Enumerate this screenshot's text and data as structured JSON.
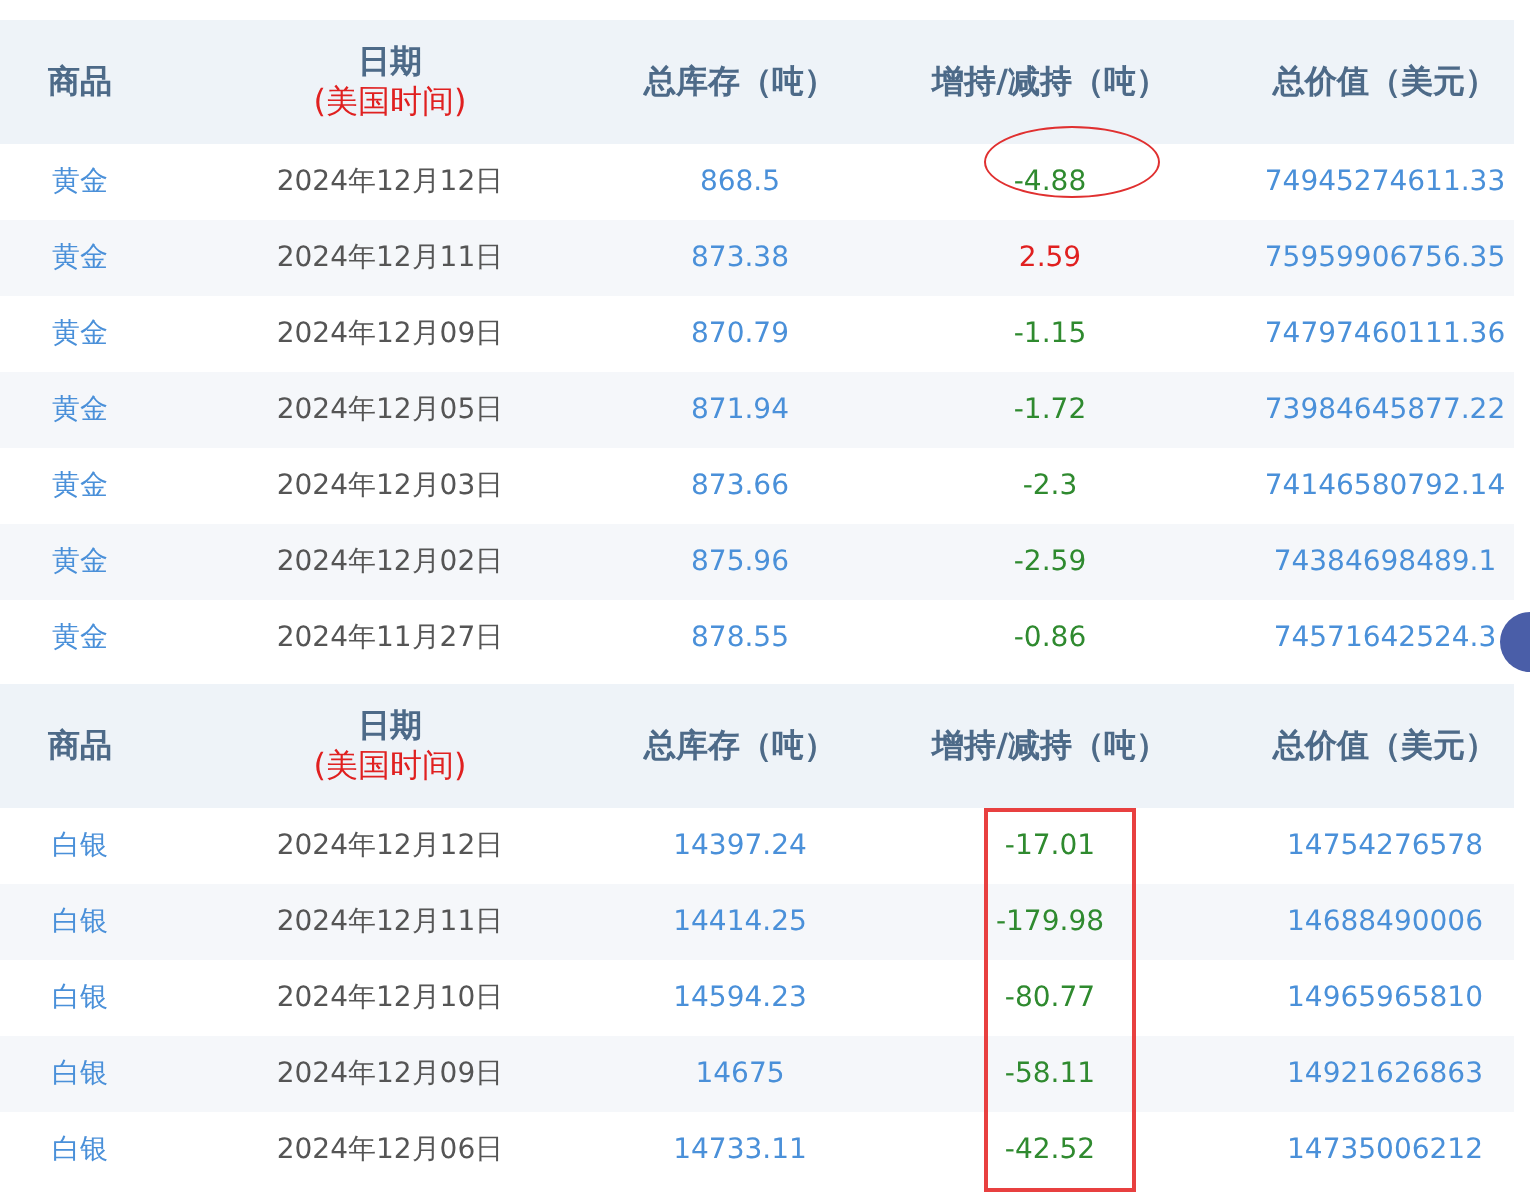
{
  "tables": [
    {
      "columns": [
        {
          "label": "商品"
        },
        {
          "label": "日期",
          "sublabel": "(美国时间)"
        },
        {
          "label": "总库存（吨）"
        },
        {
          "label": "增持/减持（吨）"
        },
        {
          "label": "总价值（美元）"
        }
      ],
      "rows": [
        {
          "commodity": "黄金",
          "date": "2024年12月12日",
          "stock": "868.5",
          "change": "-4.88",
          "color": "#2f8a2f",
          "value": "74945274611.33",
          "circled": true
        },
        {
          "commodity": "黄金",
          "date": "2024年12月11日",
          "stock": "873.38",
          "change": "2.59",
          "color": "#e02020",
          "value": "75959906756.35",
          "circled": false
        },
        {
          "commodity": "黄金",
          "date": "2024年12月09日",
          "stock": "870.79",
          "change": "-1.15",
          "color": "#2f8a2f",
          "value": "74797460111.36",
          "circled": false
        },
        {
          "commodity": "黄金",
          "date": "2024年12月05日",
          "stock": "871.94",
          "change": "-1.72",
          "color": "#2f8a2f",
          "value": "73984645877.22",
          "circled": false
        },
        {
          "commodity": "黄金",
          "date": "2024年12月03日",
          "stock": "873.66",
          "change": "-2.3",
          "color": "#2f8a2f",
          "value": "74146580792.14",
          "circled": false
        },
        {
          "commodity": "黄金",
          "date": "2024年12月02日",
          "stock": "875.96",
          "change": "-2.59",
          "color": "#2f8a2f",
          "value": "74384698489.1",
          "circled": false
        },
        {
          "commodity": "黄金",
          "date": "2024年11月27日",
          "stock": "878.55",
          "change": "-0.86",
          "color": "#2f8a2f",
          "value": "74571642524.3",
          "circled": false
        }
      ]
    },
    {
      "columns": [
        {
          "label": "商品"
        },
        {
          "label": "日期",
          "sublabel": "(美国时间)"
        },
        {
          "label": "总库存（吨）"
        },
        {
          "label": "增持/减持（吨）"
        },
        {
          "label": "总价值（美元）"
        }
      ],
      "change_boxed": true,
      "rows": [
        {
          "commodity": "白银",
          "date": "2024年12月12日",
          "stock": "14397.24",
          "change": "-17.01",
          "color": "#2f8a2f",
          "value": "14754276578",
          "circled": false
        },
        {
          "commodity": "白银",
          "date": "2024年12月11日",
          "stock": "14414.25",
          "change": "-179.98",
          "color": "#2f8a2f",
          "value": "14688490006",
          "circled": false
        },
        {
          "commodity": "白银",
          "date": "2024年12月10日",
          "stock": "14594.23",
          "change": "-80.77",
          "color": "#2f8a2f",
          "value": "14965965810",
          "circled": false
        },
        {
          "commodity": "白银",
          "date": "2024年12月09日",
          "stock": "14675",
          "change": "-58.11",
          "color": "#2f8a2f",
          "value": "14921626863",
          "circled": false
        },
        {
          "commodity": "白银",
          "date": "2024年12月06日",
          "stock": "14733.11",
          "change": "-42.52",
          "color": "#2f8a2f",
          "value": "14735006212",
          "circled": false
        }
      ]
    }
  ]
}
